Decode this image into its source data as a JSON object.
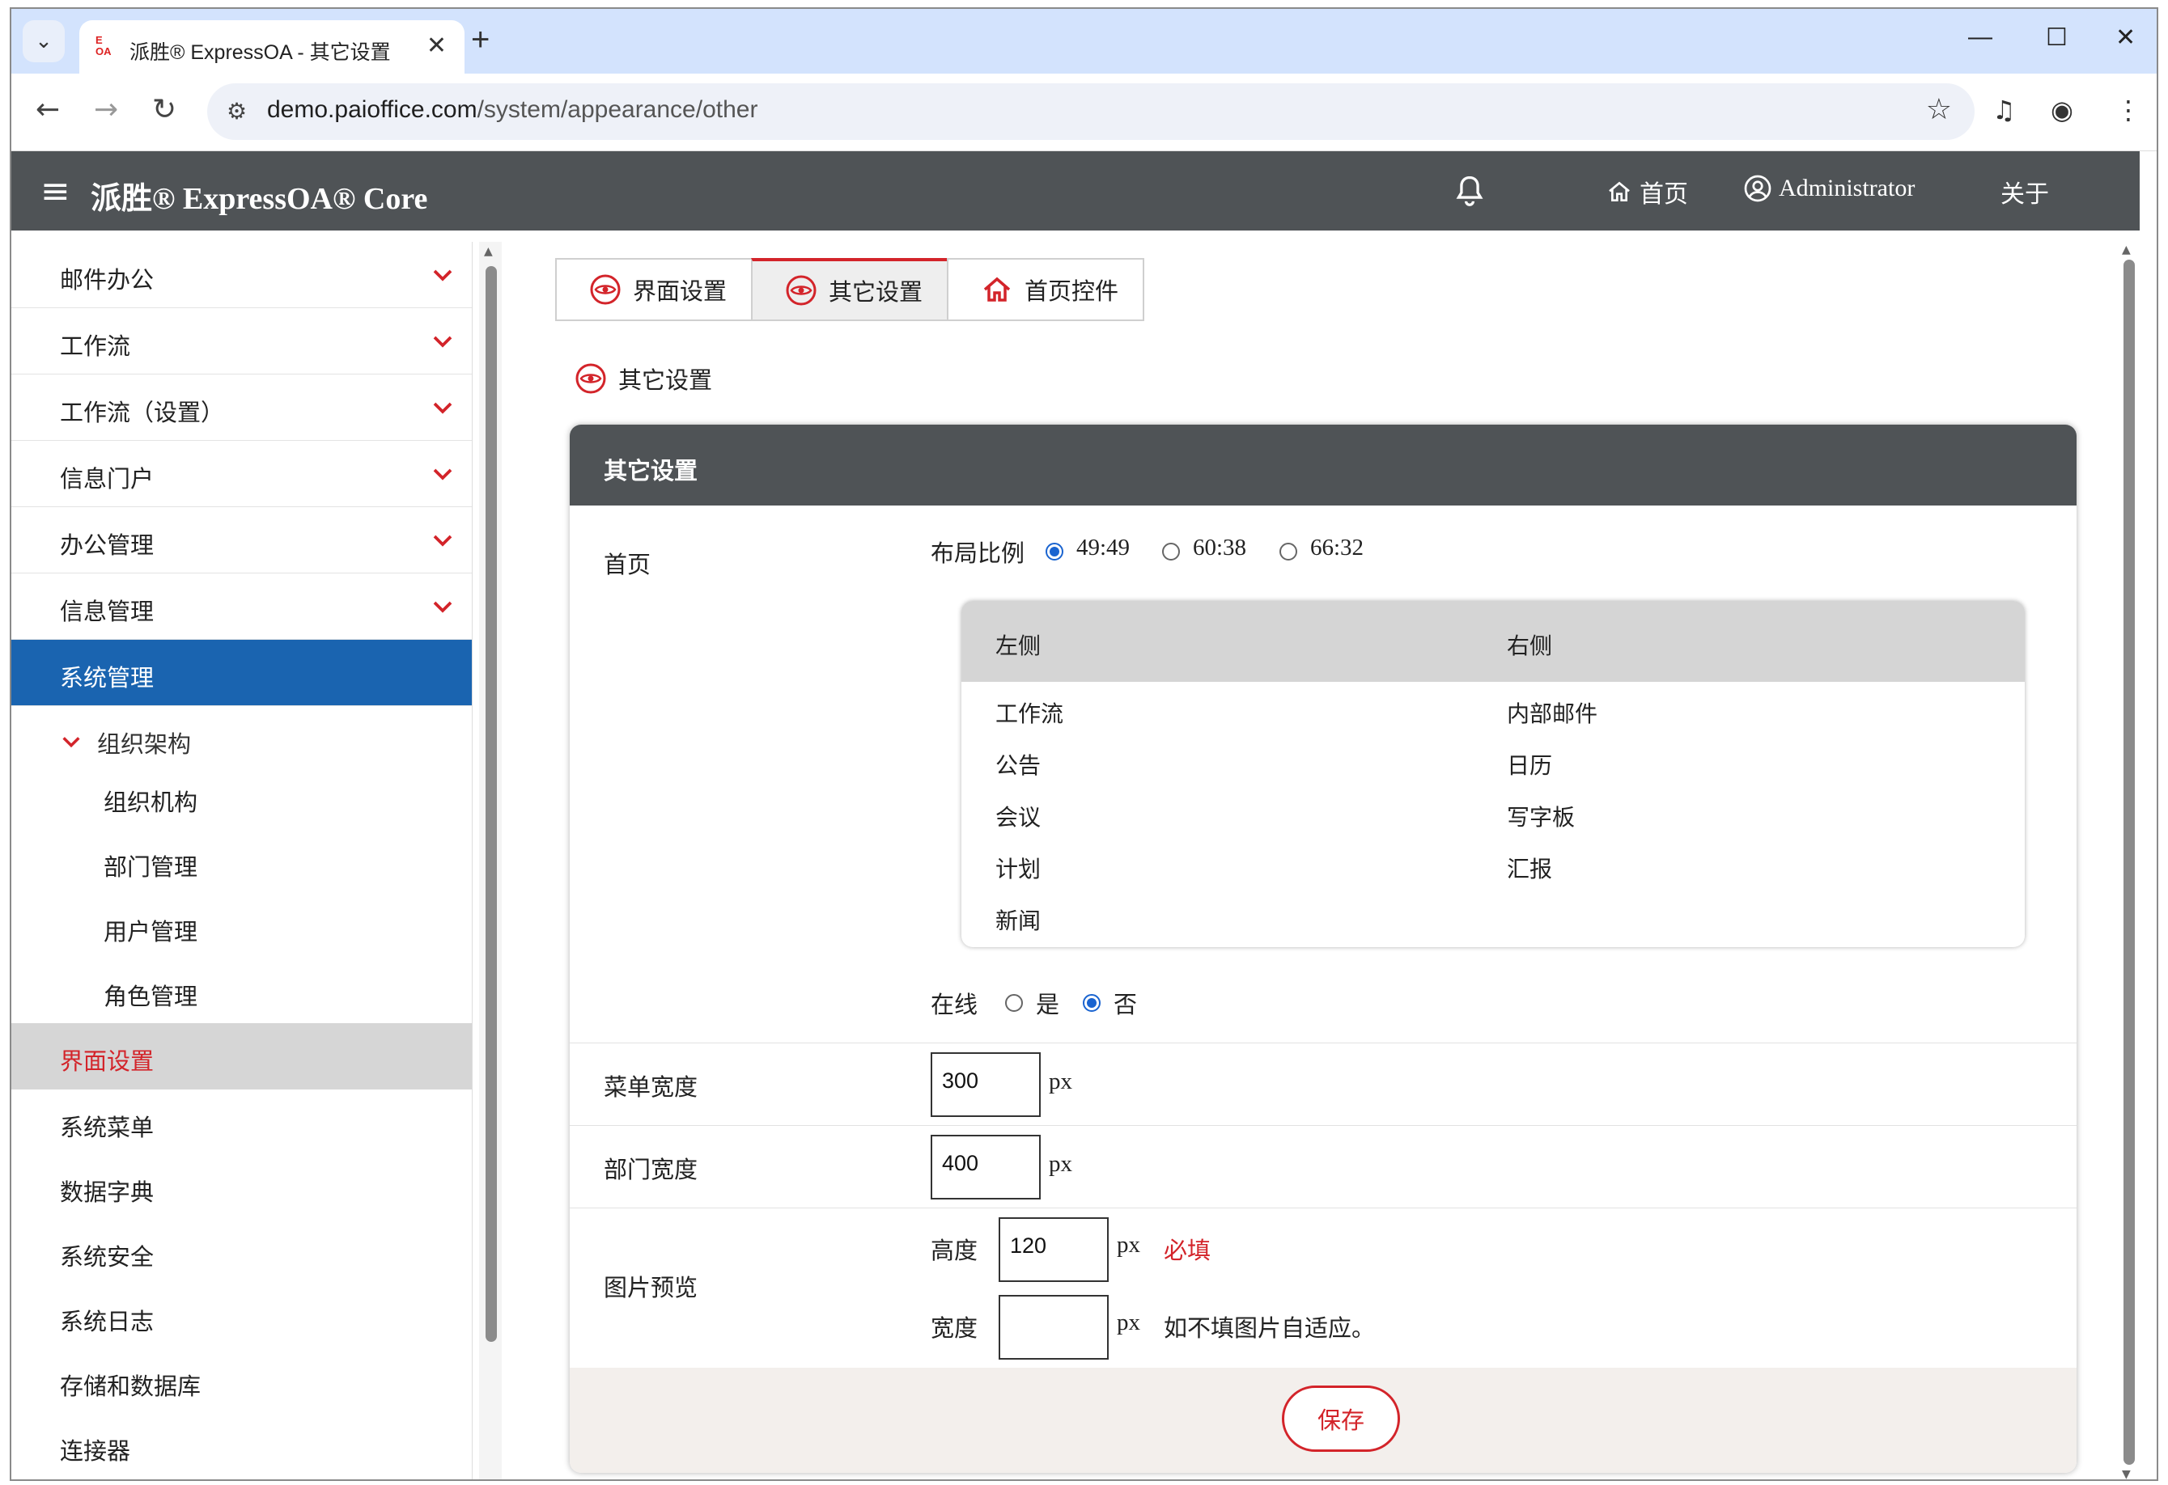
{
  "browser": {
    "tab_title": "派胜® ExpressOA - 其它设置",
    "tab_favicon_top": "E",
    "tab_favicon_bottom": "OA",
    "tab_close": "✕",
    "new_tab": "+",
    "url_host": "demo.paioffice.com",
    "url_path": "/system/appearance/other",
    "minimize": "—",
    "maximize": "☐",
    "close": "✕"
  },
  "topnav": {
    "brand": "派胜® ExpressOA® Core",
    "home_label": "首页",
    "user_label": "Administrator",
    "about_label": "关于"
  },
  "sidebar": {
    "items": [
      {
        "label": "邮件办公"
      },
      {
        "label": "工作流"
      },
      {
        "label": "工作流（设置）"
      },
      {
        "label": "信息门户"
      },
      {
        "label": "办公管理"
      },
      {
        "label": "信息管理"
      },
      {
        "label": "系统管理"
      }
    ],
    "group_label": "组织架构",
    "sub_items": [
      {
        "label": "组织机构"
      },
      {
        "label": "部门管理"
      },
      {
        "label": "用户管理"
      },
      {
        "label": "角色管理"
      }
    ],
    "selected_label": "界面设置",
    "lower_items": [
      {
        "label": "系统菜单"
      },
      {
        "label": "数据字典"
      },
      {
        "label": "系统安全"
      },
      {
        "label": "系统日志"
      },
      {
        "label": "存储和数据库"
      },
      {
        "label": "连接器"
      }
    ]
  },
  "tabs": [
    {
      "label": "界面设置",
      "icon": "eye-icon",
      "active": false
    },
    {
      "label": "其它设置",
      "icon": "eye-icon",
      "active": true
    },
    {
      "label": "首页控件",
      "icon": "home-icon",
      "active": false
    }
  ],
  "section_title": "其它设置",
  "panel": {
    "title": "其它设置",
    "home_row": {
      "label": "首页",
      "layout_label": "布局比例",
      "layout_options": [
        "49:49",
        "60:38",
        "66:32"
      ],
      "layout_selected": "49:49",
      "table": {
        "left_header": "左侧",
        "right_header": "右侧",
        "left_items": [
          "工作流",
          "公告",
          "会议",
          "计划",
          "新闻"
        ],
        "right_items": [
          "内部邮件",
          "日历",
          "写字板",
          "汇报"
        ]
      },
      "online_label": "在线",
      "online_options": [
        "是",
        "否"
      ],
      "online_selected": "否"
    },
    "menu_width": {
      "label": "菜单宽度",
      "value": "300",
      "unit": "px"
    },
    "dept_width": {
      "label": "部门宽度",
      "value": "400",
      "unit": "px"
    },
    "image_preview": {
      "label": "图片预览",
      "height_label": "高度",
      "height_value": "120",
      "height_unit": "px",
      "required_text": "必填",
      "width_label": "宽度",
      "width_value": "",
      "width_unit": "px",
      "width_hint": "如不填图片自适应。"
    },
    "save_label": "保存"
  },
  "colors": {
    "accent_red": "#d3242a",
    "nav_dark": "#4f5356",
    "active_blue": "#1a64b0"
  }
}
